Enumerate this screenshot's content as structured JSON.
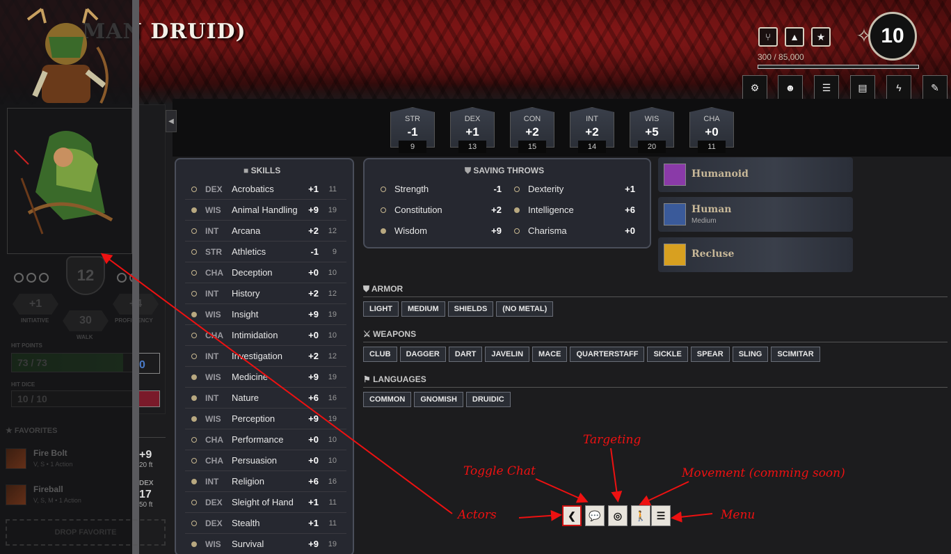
{
  "character": {
    "name": "MAN DRUID)"
  },
  "header": {
    "icons": [
      "utensils-icon",
      "camp-icon",
      "star-icon"
    ],
    "xp": "300 / 85,000",
    "level": "10",
    "toolbar": [
      "gear-icon",
      "people-icon",
      "list-icon",
      "book-icon",
      "bolt-icon",
      "feather-icon"
    ]
  },
  "sidebar": {
    "level_shield": "12",
    "initiative": {
      "value": "+1",
      "label": "INITIATIVE"
    },
    "walk": {
      "value": "30",
      "label": "WALK"
    },
    "proficiency": {
      "value": "+4",
      "label": "PROFICIENCY"
    },
    "hit_points": {
      "label": "HIT POINTS",
      "value": "73 / 73",
      "temp": "0"
    },
    "hit_dice": {
      "label": "HIT DICE",
      "value": "10 / 10"
    },
    "favorites_label": "FAVORITES",
    "favorites": [
      {
        "name": "Fire Bolt",
        "sub": "V, S • 1 Action"
      },
      {
        "name": "Fireball",
        "sub": "V, S, M • 1 Action"
      }
    ],
    "drop_favorite": "DROP FAVORITE",
    "right_stats": [
      {
        "value": "+9",
        "sub": "20 ft"
      },
      {
        "label": "DEX",
        "value": "17",
        "sub": "50 ft"
      }
    ]
  },
  "abilities": [
    {
      "abbr": "STR",
      "mod": "-1",
      "score": "9"
    },
    {
      "abbr": "DEX",
      "mod": "+1",
      "score": "13"
    },
    {
      "abbr": "CON",
      "mod": "+2",
      "score": "15"
    },
    {
      "abbr": "INT",
      "mod": "+2",
      "score": "14"
    },
    {
      "abbr": "WIS",
      "mod": "+5",
      "score": "20"
    },
    {
      "abbr": "CHA",
      "mod": "+0",
      "score": "11"
    }
  ],
  "skills": {
    "title": "SKILLS",
    "rows": [
      {
        "prof": false,
        "ab": "DEX",
        "name": "Acrobatics",
        "bonus": "+1",
        "passive": "11"
      },
      {
        "prof": true,
        "ab": "WIS",
        "name": "Animal Handling",
        "bonus": "+9",
        "passive": "19"
      },
      {
        "prof": false,
        "ab": "INT",
        "name": "Arcana",
        "bonus": "+2",
        "passive": "12"
      },
      {
        "prof": false,
        "ab": "STR",
        "name": "Athletics",
        "bonus": "-1",
        "passive": "9"
      },
      {
        "prof": false,
        "ab": "CHA",
        "name": "Deception",
        "bonus": "+0",
        "passive": "10"
      },
      {
        "prof": false,
        "ab": "INT",
        "name": "History",
        "bonus": "+2",
        "passive": "12"
      },
      {
        "prof": true,
        "ab": "WIS",
        "name": "Insight",
        "bonus": "+9",
        "passive": "19"
      },
      {
        "prof": false,
        "ab": "CHA",
        "name": "Intimidation",
        "bonus": "+0",
        "passive": "10"
      },
      {
        "prof": false,
        "ab": "INT",
        "name": "Investigation",
        "bonus": "+2",
        "passive": "12"
      },
      {
        "prof": true,
        "ab": "WIS",
        "name": "Medicine",
        "bonus": "+9",
        "passive": "19"
      },
      {
        "prof": true,
        "ab": "INT",
        "name": "Nature",
        "bonus": "+6",
        "passive": "16"
      },
      {
        "prof": true,
        "ab": "WIS",
        "name": "Perception",
        "bonus": "+9",
        "passive": "19"
      },
      {
        "prof": false,
        "ab": "CHA",
        "name": "Performance",
        "bonus": "+0",
        "passive": "10"
      },
      {
        "prof": false,
        "ab": "CHA",
        "name": "Persuasion",
        "bonus": "+0",
        "passive": "10"
      },
      {
        "prof": true,
        "ab": "INT",
        "name": "Religion",
        "bonus": "+6",
        "passive": "16"
      },
      {
        "prof": false,
        "ab": "DEX",
        "name": "Sleight of Hand",
        "bonus": "+1",
        "passive": "11"
      },
      {
        "prof": false,
        "ab": "DEX",
        "name": "Stealth",
        "bonus": "+1",
        "passive": "11"
      },
      {
        "prof": true,
        "ab": "WIS",
        "name": "Survival",
        "bonus": "+9",
        "passive": "19"
      }
    ]
  },
  "saving_throws": {
    "title": "SAVING THROWS",
    "rows": [
      {
        "prof": false,
        "name": "Strength",
        "bonus": "-1"
      },
      {
        "prof": false,
        "name": "Dexterity",
        "bonus": "+1"
      },
      {
        "prof": false,
        "name": "Constitution",
        "bonus": "+2"
      },
      {
        "prof": true,
        "name": "Intelligence",
        "bonus": "+6"
      },
      {
        "prof": true,
        "name": "Wisdom",
        "bonus": "+9"
      },
      {
        "prof": false,
        "name": "Charisma",
        "bonus": "+0"
      }
    ]
  },
  "traits": [
    {
      "name": "Humanoid",
      "sub": "",
      "color": "#8a3aa8"
    },
    {
      "name": "Human",
      "sub": "Medium",
      "color": "#3a5a9a"
    },
    {
      "name": "Recluse",
      "sub": "",
      "color": "#d8a020"
    }
  ],
  "armor": {
    "label": "ARMOR",
    "tags": [
      "LIGHT",
      "MEDIUM",
      "SHIELDS",
      "(NO METAL)"
    ]
  },
  "weapons": {
    "label": "WEAPONS",
    "tags": [
      "CLUB",
      "DAGGER",
      "DART",
      "JAVELIN",
      "MACE",
      "QUARTERSTAFF",
      "SICKLE",
      "SPEAR",
      "SLING",
      "SCIMITAR"
    ]
  },
  "languages": {
    "label": "LANGUAGES",
    "tags": [
      "COMMON",
      "GNOMISH",
      "DRUIDIC"
    ]
  },
  "bottom_toolbar": [
    "chevron-left-icon",
    "chat-icon",
    "target-icon",
    "walk-icon",
    "menu-icon"
  ],
  "annotations": {
    "targeting": "Targeting",
    "toggle_chat": "Toggle Chat",
    "movement": "Movement (comming soon)",
    "actors": "Actors",
    "menu": "Menu"
  },
  "colors": {
    "accent_red": "#ee1111",
    "prof_dot": "#b8a880"
  }
}
